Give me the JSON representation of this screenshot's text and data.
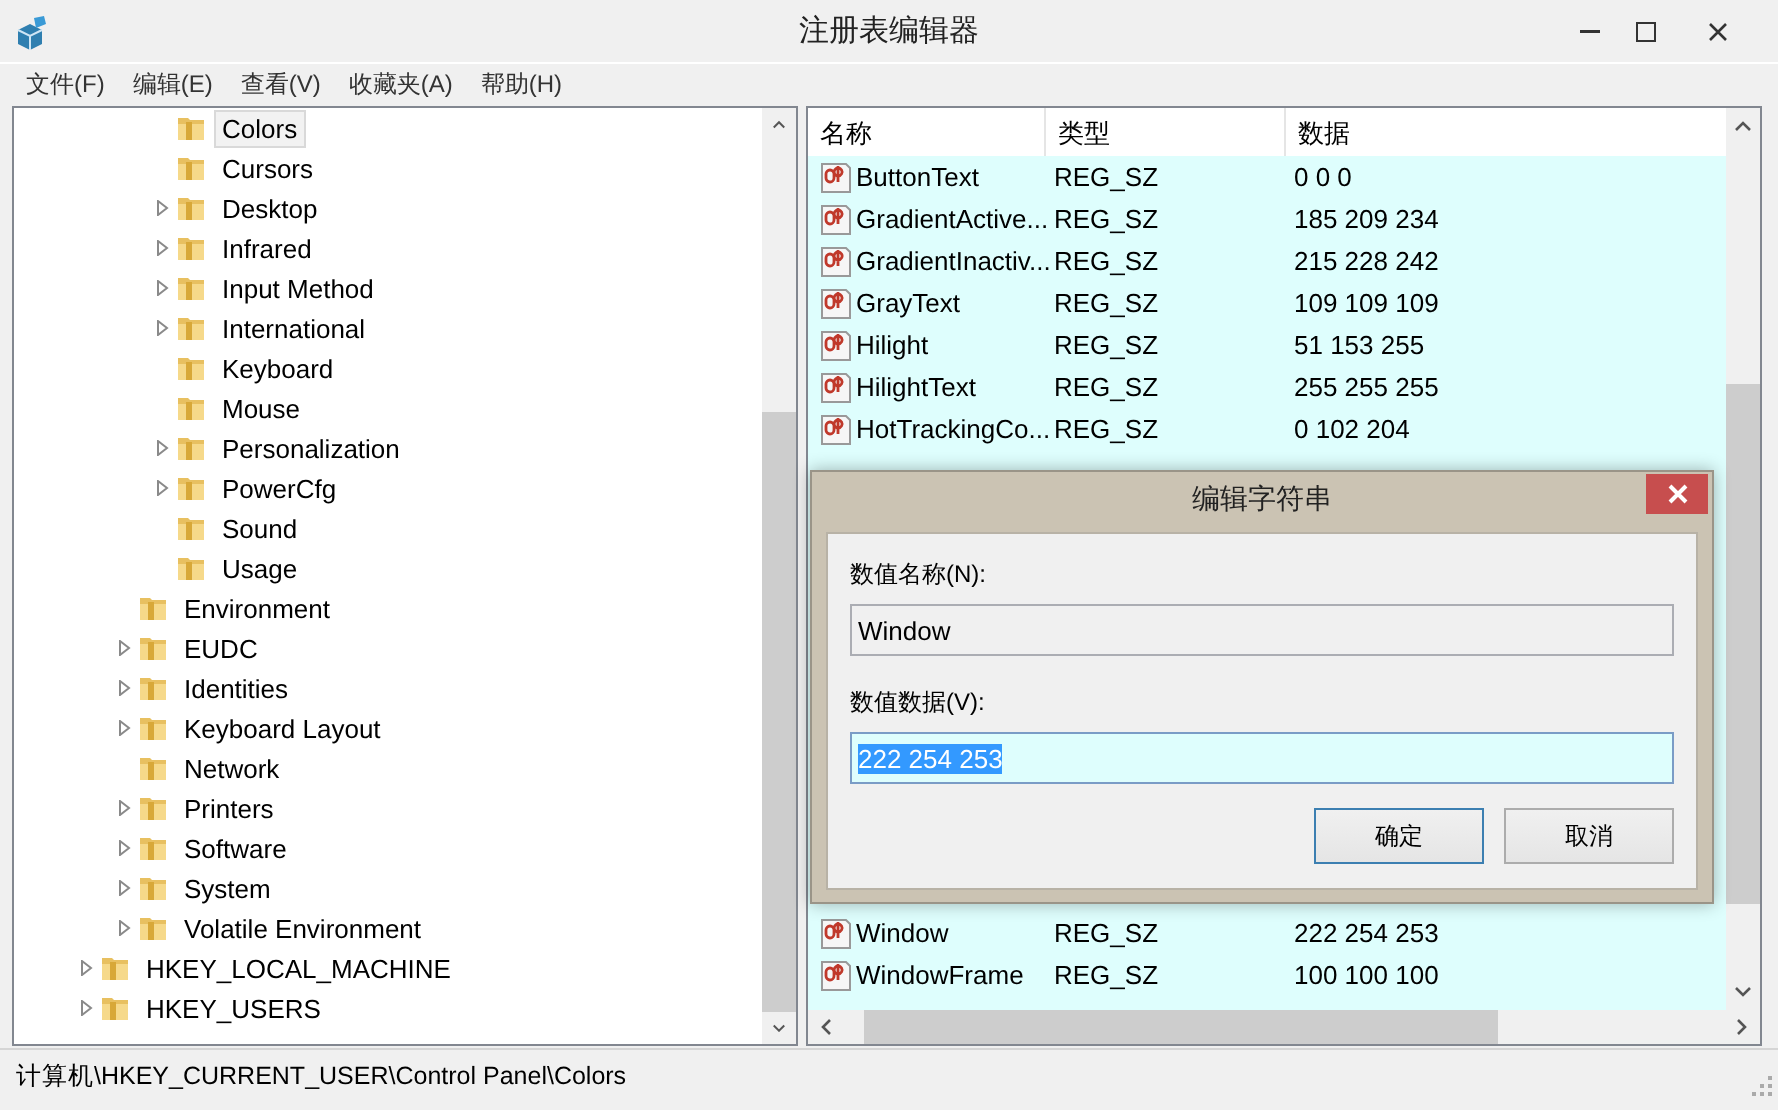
{
  "window": {
    "title": "注册表编辑器"
  },
  "menu": [
    {
      "label": "文件(F)"
    },
    {
      "label": "编辑(E)"
    },
    {
      "label": "查看(V)"
    },
    {
      "label": "收藏夹(A)"
    },
    {
      "label": "帮助(H)"
    }
  ],
  "tree": {
    "items": [
      {
        "children": [
          {
            "children": [
              {
                "children": [
                  {
                    "label": "Colors",
                    "expandable": false,
                    "selected": true
                  },
                  {
                    "label": "Cursors",
                    "expandable": false,
                    "selected": false
                  },
                  {
                    "label": "Desktop",
                    "expandable": true,
                    "selected": false
                  },
                  {
                    "label": "Infrared",
                    "expandable": true,
                    "selected": false
                  },
                  {
                    "label": "Input Method",
                    "expandable": true,
                    "selected": false
                  },
                  {
                    "label": "International",
                    "expandable": true,
                    "selected": false
                  },
                  {
                    "label": "Keyboard",
                    "expandable": false,
                    "selected": false
                  },
                  {
                    "label": "Mouse",
                    "expandable": false,
                    "selected": false
                  },
                  {
                    "label": "Personalization",
                    "expandable": true,
                    "selected": false
                  },
                  {
                    "label": "PowerCfg",
                    "expandable": true,
                    "selected": false
                  },
                  {
                    "label": "Sound",
                    "expandable": false,
                    "selected": false
                  },
                  {
                    "label": "Usage",
                    "expandable": false,
                    "selected": false
                  }
                ]
              },
              {
                "label": "Environment",
                "expandable": false,
                "selected": false
              },
              {
                "label": "EUDC",
                "expandable": true,
                "selected": false
              },
              {
                "label": "Identities",
                "expandable": true,
                "selected": false
              },
              {
                "label": "Keyboard Layout",
                "expandable": true,
                "selected": false
              },
              {
                "label": "Network",
                "expandable": false,
                "selected": false
              },
              {
                "label": "Printers",
                "expandable": true,
                "selected": false
              },
              {
                "label": "Software",
                "expandable": true,
                "selected": false
              },
              {
                "label": "System",
                "expandable": true,
                "selected": false
              },
              {
                "label": "Volatile Environment",
                "expandable": true,
                "selected": false
              }
            ]
          },
          {
            "label": "HKEY_LOCAL_MACHINE",
            "expandable": true,
            "selected": false
          },
          {
            "label": "HKEY_USERS",
            "expandable": true,
            "selected": false
          }
        ]
      }
    ]
  },
  "table": {
    "columns": [
      "名称",
      "类型",
      "数据"
    ],
    "rows": [
      {
        "name": "ButtonText",
        "type": "REG_SZ",
        "data": "0 0 0"
      },
      {
        "name": "GradientActive...",
        "type": "REG_SZ",
        "data": "185 209 234"
      },
      {
        "name": "GradientInactiv...",
        "type": "REG_SZ",
        "data": "215 228 242"
      },
      {
        "name": "GrayText",
        "type": "REG_SZ",
        "data": "109 109 109"
      },
      {
        "name": "Hilight",
        "type": "REG_SZ",
        "data": "51 153 255"
      },
      {
        "name": "HilightText",
        "type": "REG_SZ",
        "data": "255 255 255"
      },
      {
        "name": "HotTrackingCo...",
        "type": "REG_SZ",
        "data": "0 102 204"
      }
    ],
    "rows_below_dialog": [
      {
        "name": "Window",
        "type": "REG_SZ",
        "data": "222 254 253"
      },
      {
        "name": "WindowFrame",
        "type": "REG_SZ",
        "data": "100 100 100"
      }
    ]
  },
  "dialog": {
    "title": "编辑字符串",
    "name_label": "数值名称(N):",
    "name_value": "Window",
    "data_label": "数值数据(V):",
    "data_value": "222 254 253",
    "data_text_selected": true,
    "buttons": [
      {
        "label": "确定",
        "default": true
      },
      {
        "label": "取消",
        "default": false
      }
    ]
  },
  "status_bar": "计算机\\HKEY_CURRENT_USER\\Control Panel\\Colors"
}
